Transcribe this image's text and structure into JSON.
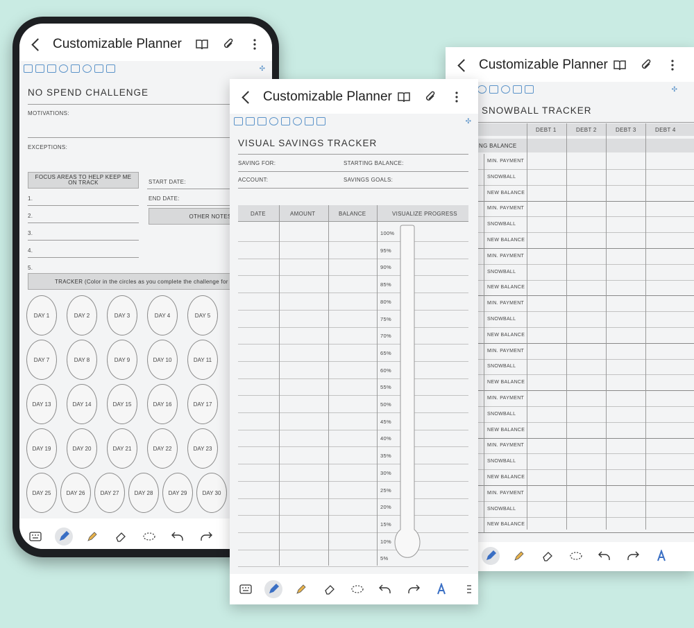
{
  "app_title": "Customizable Planner",
  "icons": {
    "back": "chevron-left-icon",
    "book": "book-icon",
    "attach": "paperclip-icon",
    "more": "more-vertical-icon"
  },
  "colors": {
    "accent": "#5b93c9",
    "background": "#c9ebe3",
    "pen": "#3a6fc4",
    "highlighter": "#e8b24a"
  },
  "no_spend": {
    "title": "NO SPEND CHALLENGE",
    "motivations": "MOTIVATIONS:",
    "exceptions": "EXCEPTIONS:",
    "focus": "FOCUS AREAS TO HELP KEEP ME ON TRACK",
    "start_date": "START DATE:",
    "end_date": "END DATE:",
    "other_notes": "OTHER NOTES",
    "numbers": [
      "1.",
      "2.",
      "3.",
      "4.",
      "5."
    ],
    "tracker": "TRACKER (Color in the circles as you complete the challenge for that day",
    "days": [
      "DAY 1",
      "DAY 2",
      "DAY 3",
      "DAY 4",
      "DAY 5",
      "DAY 7",
      "DAY 8",
      "DAY 9",
      "DAY 10",
      "DAY 11",
      "DAY 13",
      "DAY 14",
      "DAY 15",
      "DAY 16",
      "DAY 17",
      "DAY 19",
      "DAY 20",
      "DAY 21",
      "DAY 22",
      "DAY 23",
      "DAY 25",
      "DAY 26",
      "DAY 27",
      "DAY 28",
      "DAY 29",
      "DAY 30"
    ]
  },
  "savings": {
    "title": "VISUAL SAVINGS TRACKER",
    "saving_for": "SAVING FOR:",
    "starting_balance": "STARTING BALANCE:",
    "account": "ACCOUNT:",
    "savings_goals": "SAVINGS GOALS:",
    "headers": [
      "DATE",
      "AMOUNT",
      "BALANCE",
      "VISUALIZE PROGRESS"
    ],
    "percents": [
      "100%",
      "95%",
      "90%",
      "85%",
      "80%",
      "75%",
      "70%",
      "65%",
      "60%",
      "55%",
      "50%",
      "45%",
      "40%",
      "35%",
      "30%",
      "25%",
      "20%",
      "15%",
      "10%",
      "5%"
    ]
  },
  "snowball": {
    "title": "SNOWBALL TRACKER",
    "headers": [
      "DEBT 1",
      "DEBT 2",
      "DEBT 3",
      "DEBT 4"
    ],
    "starting_label": "NG BALANCE",
    "row_labels": [
      "MIN. PAYMENT",
      "SNOWBALL",
      "NEW BALANCE",
      "MIN. PAYMENT",
      "SNOWBALL",
      "NEW BALANCE",
      "MIN. PAYMENT",
      "SNOWBALL",
      "NEW BALANCE",
      "MIN. PAYMENT",
      "SNOWBALL",
      "NEW BALANCE",
      "MIN. PAYMENT",
      "SNOWBALL",
      "NEW BALANCE",
      "MIN. PAYMENT",
      "SNOWBALL",
      "NEW BALANCE",
      "MIN. PAYMENT",
      "SNOWBALL",
      "NEW BALANCE",
      "MIN. PAYMENT",
      "SNOWBALL",
      "NEW BALANCE"
    ]
  }
}
